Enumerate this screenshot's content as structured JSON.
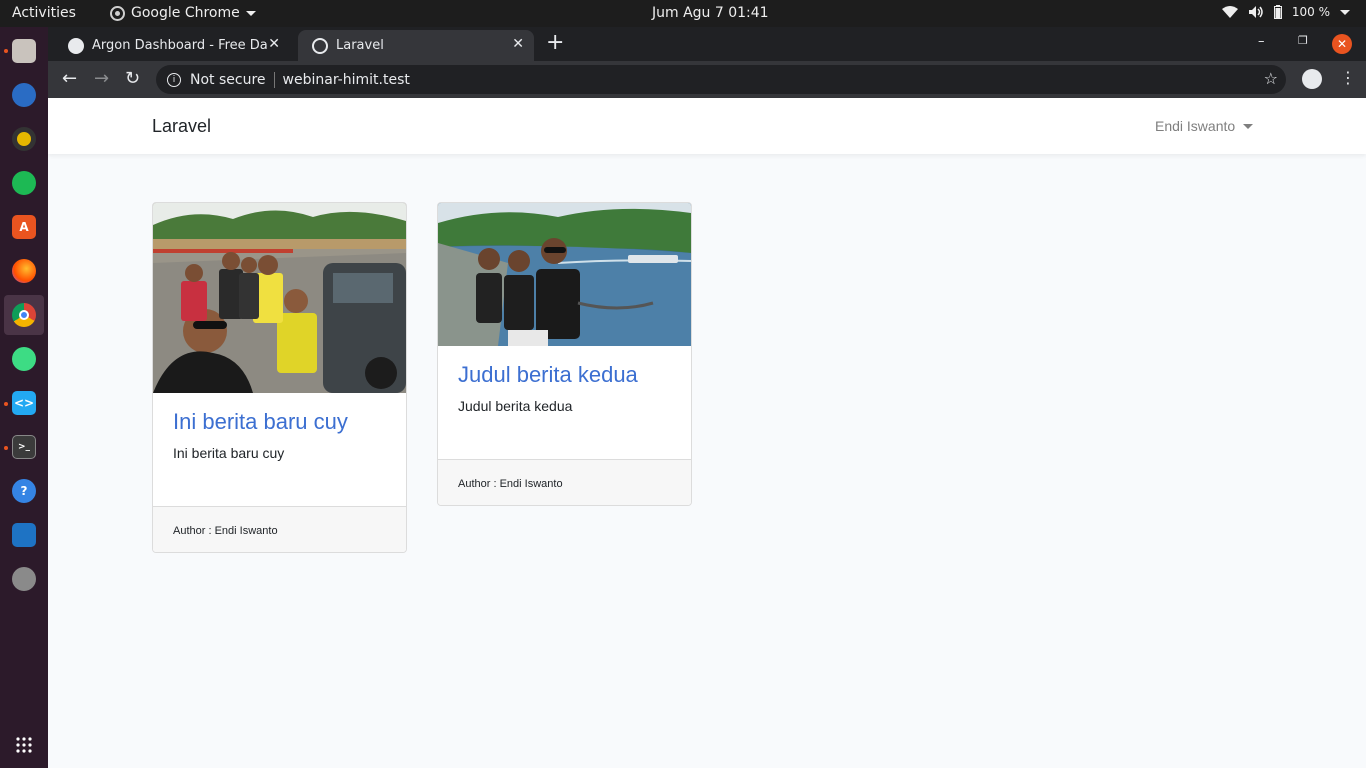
{
  "system": {
    "activities": "Activities",
    "app_name": "Google Chrome",
    "clock": "Jum Agu 7  01:41",
    "battery": "100 %"
  },
  "dock": {
    "apps": [
      "files-icon",
      "thunderbird-icon",
      "rhythmbox-icon",
      "spotify-icon",
      "software-center-icon",
      "firefox-icon",
      "chrome-icon",
      "android-studio-icon",
      "vscode-icon",
      "terminal-icon",
      "help-icon",
      "writer-icon",
      "disc-icon",
      "app-grid-icon"
    ]
  },
  "browser": {
    "tabs": [
      {
        "title": "Argon Dashboard - Free Dash"
      },
      {
        "title": "Laravel"
      }
    ],
    "security_label": "Not secure",
    "url": "webinar-himit.test"
  },
  "page": {
    "brand": "Laravel",
    "user_name": "Endi Iswanto",
    "cards": [
      {
        "title": "Ini berita baru cuy",
        "text": "Ini berita baru cuy",
        "footer": "Author : Endi Iswanto"
      },
      {
        "title": "Judul berita kedua",
        "text": "Judul berita kedua",
        "footer": "Author : Endi Iswanto"
      }
    ]
  },
  "colors": {
    "link_blue": "#3c6fd1",
    "ubuntu_orange": "#e95420",
    "chrome_dark": "#35363a"
  }
}
